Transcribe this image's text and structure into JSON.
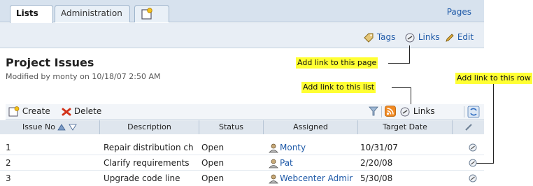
{
  "tabs": {
    "lists": "Lists",
    "administration": "Administration"
  },
  "header": {
    "pages_link": "Pages"
  },
  "toolbar": {
    "tags": "Tags",
    "links": "Links",
    "edit": "Edit"
  },
  "page": {
    "title": "Project Issues",
    "modified": "Modified by monty on 10/18/07 2:50 AM"
  },
  "callouts": {
    "page": "Add link to this page",
    "list": "Add link to  this list",
    "row": "Add link to this row"
  },
  "list_toolbar": {
    "create": "Create",
    "delete": "Delete",
    "links": "Links"
  },
  "table": {
    "columns": [
      "Issue No",
      "Description",
      "Status",
      "Assigned",
      "Target Date"
    ],
    "rows": [
      {
        "no": "1",
        "description": "Repair distribution ch",
        "status": "Open",
        "assigned": "Monty",
        "target": "10/31/07"
      },
      {
        "no": "2",
        "description": "Clarify requirements",
        "status": "Open",
        "assigned": "Pat",
        "target": "2/20/08"
      },
      {
        "no": "3",
        "description": "Upgrade code line",
        "status": "Open",
        "assigned": "Webcenter Admir",
        "target": "5/30/08"
      }
    ]
  },
  "colors": {
    "tabbar": "#d7e2ee",
    "link": "#1f5aa8",
    "callout": "#ffff33",
    "header": "#dfe6ee"
  }
}
